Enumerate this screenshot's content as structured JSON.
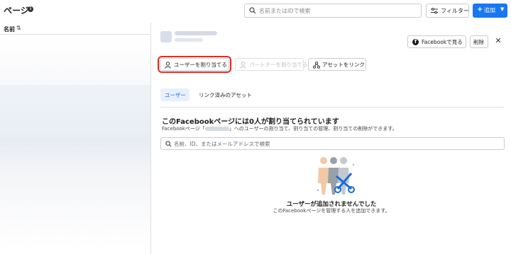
{
  "header": {
    "title": "ページ",
    "search_placeholder": "名前またはIDで検索",
    "filter_label": "フィルター",
    "add_label": "追加"
  },
  "list": {
    "column_header": "名前"
  },
  "detail": {
    "view_on_facebook": "Facebookで見る",
    "delete": "削除",
    "actions": {
      "assign_user": "ユーザーを割り当てる",
      "assign_partner": "パートナーを割り当てる",
      "link_asset": "アセットをリンク"
    },
    "tabs": [
      "ユーザー",
      "リンク済みのアセット"
    ],
    "section_title": "このFacebookページには0人が割り当てられています",
    "section_desc_prefix": "Facebookページ「",
    "section_desc_suffix": "」へのユーザーの割り当て、割り当ての管理、割り当ての削除ができます。",
    "user_search_placeholder": "名前、ID、またはメールアドレスで検索",
    "empty_title": "ユーザーが追加されませんでした",
    "empty_subtitle": "このFacebookページを管理する人を追加できます。"
  },
  "colors": {
    "primary": "#1877f2",
    "highlight": "#d93025",
    "active_tab_bg": "#e7f0fd"
  }
}
